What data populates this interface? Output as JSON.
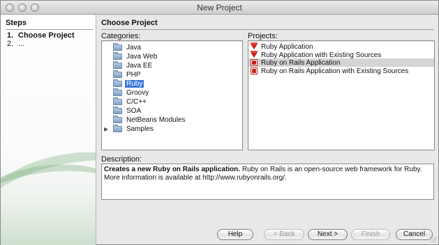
{
  "window": {
    "title": "New Project"
  },
  "steps": {
    "header": "Steps",
    "items": [
      {
        "num": "1.",
        "label": "Choose Project",
        "active": true
      },
      {
        "num": "2.",
        "label": "...",
        "active": false
      }
    ]
  },
  "main": {
    "title": "Choose Project",
    "categories_label": "Categories:",
    "projects_label": "Projects:",
    "description_label": "Description:"
  },
  "categories": [
    {
      "label": "Java",
      "icon": "folder-icon",
      "selected": false,
      "expandable": false
    },
    {
      "label": "Java Web",
      "icon": "folder-icon",
      "selected": false,
      "expandable": false
    },
    {
      "label": "Java EE",
      "icon": "folder-icon",
      "selected": false,
      "expandable": false
    },
    {
      "label": "PHP",
      "icon": "folder-icon",
      "selected": false,
      "expandable": false
    },
    {
      "label": "Ruby",
      "icon": "folder-icon",
      "selected": true,
      "expandable": false
    },
    {
      "label": "Groovy",
      "icon": "folder-icon",
      "selected": false,
      "expandable": false
    },
    {
      "label": "C/C++",
      "icon": "folder-icon",
      "selected": false,
      "expandable": false
    },
    {
      "label": "SOA",
      "icon": "folder-icon",
      "selected": false,
      "expandable": false
    },
    {
      "label": "NetBeans Modules",
      "icon": "folder-icon",
      "selected": false,
      "expandable": false
    },
    {
      "label": "Samples",
      "icon": "folder-icon",
      "selected": false,
      "expandable": true
    }
  ],
  "projects": [
    {
      "label": "Ruby Application",
      "icon": "ruby-gem-icon",
      "selected": false
    },
    {
      "label": "Ruby Application with Existing Sources",
      "icon": "ruby-gem-icon",
      "selected": false
    },
    {
      "label": "Ruby on Rails Application",
      "icon": "rails-icon",
      "selected": true
    },
    {
      "label": "Ruby on Rails Application with Existing Sources",
      "icon": "rails-icon",
      "selected": false
    }
  ],
  "description": {
    "bold": "Creates a new Ruby on Rails application.",
    "text": " Ruby on Rails is an open-source web framework for Ruby. More information is available at http://www.rubyonrails.org/."
  },
  "buttons": {
    "help": "Help",
    "back": "< Back",
    "next": "Next >",
    "finish": "Finish",
    "cancel": "Cancel"
  },
  "colors": {
    "selection": "#3875d7",
    "project_selection": "#d4d4d4"
  }
}
